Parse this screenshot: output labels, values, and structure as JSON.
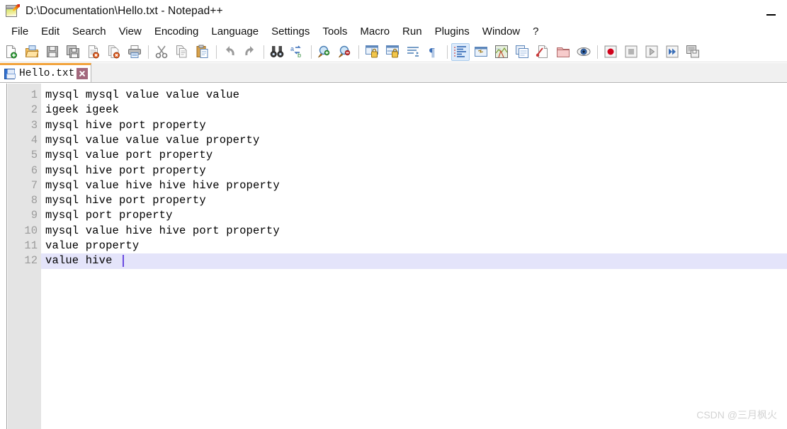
{
  "window": {
    "title": "D:\\Documentation\\Hello.txt - Notepad++",
    "app_icon": "notepad-plus-plus-icon",
    "minimize_label": "—"
  },
  "menu": {
    "items": [
      {
        "label": "File"
      },
      {
        "label": "Edit"
      },
      {
        "label": "Search"
      },
      {
        "label": "View"
      },
      {
        "label": "Encoding"
      },
      {
        "label": "Language"
      },
      {
        "label": "Settings"
      },
      {
        "label": "Tools"
      },
      {
        "label": "Macro"
      },
      {
        "label": "Run"
      },
      {
        "label": "Plugins"
      },
      {
        "label": "Window"
      },
      {
        "label": "?"
      }
    ]
  },
  "toolbar": {
    "buttons": [
      {
        "name": "new-file-icon",
        "tip": "New"
      },
      {
        "name": "open-file-icon",
        "tip": "Open"
      },
      {
        "name": "save-icon",
        "tip": "Save"
      },
      {
        "name": "save-all-icon",
        "tip": "Save All"
      },
      {
        "name": "close-file-icon",
        "tip": "Close"
      },
      {
        "name": "close-all-files-icon",
        "tip": "Close All"
      },
      {
        "name": "print-icon",
        "tip": "Print"
      },
      {
        "name": "separator",
        "tip": ""
      },
      {
        "name": "cut-icon",
        "tip": "Cut"
      },
      {
        "name": "copy-icon",
        "tip": "Copy"
      },
      {
        "name": "paste-icon",
        "tip": "Paste"
      },
      {
        "name": "separator",
        "tip": ""
      },
      {
        "name": "undo-icon",
        "tip": "Undo"
      },
      {
        "name": "redo-icon",
        "tip": "Redo"
      },
      {
        "name": "separator",
        "tip": ""
      },
      {
        "name": "find-icon",
        "tip": "Find"
      },
      {
        "name": "replace-icon",
        "tip": "Replace"
      },
      {
        "name": "separator",
        "tip": ""
      },
      {
        "name": "zoom-in-icon",
        "tip": "Zoom In"
      },
      {
        "name": "zoom-out-icon",
        "tip": "Zoom Out"
      },
      {
        "name": "separator",
        "tip": ""
      },
      {
        "name": "sync-vertical-scroll-icon",
        "tip": "Synchronize Vertical Scrolling"
      },
      {
        "name": "sync-horizontal-scroll-icon",
        "tip": "Synchronize Horizontal Scrolling"
      },
      {
        "name": "word-wrap-icon",
        "tip": "Word wrap"
      },
      {
        "name": "show-all-characters-icon",
        "tip": "Show All Characters"
      },
      {
        "name": "separator",
        "tip": ""
      },
      {
        "name": "show-indent-guide-icon",
        "tip": "Show Indent Guide",
        "active": true
      },
      {
        "name": "user-defined-dialog-icon",
        "tip": "UserDefine Dialogue"
      },
      {
        "name": "document-map-icon",
        "tip": "Document Map"
      },
      {
        "name": "function-list-icon",
        "tip": "Function List"
      },
      {
        "name": "document-switcher-icon",
        "tip": "Document Switcher"
      },
      {
        "name": "folder-as-workspace-icon",
        "tip": "Folder as Workspace"
      },
      {
        "name": "monitoring-icon",
        "tip": "Monitoring (tail -f)"
      },
      {
        "name": "separator",
        "tip": ""
      },
      {
        "name": "record-macro-icon",
        "tip": "Start Recording"
      },
      {
        "name": "stop-macro-icon",
        "tip": "Stop Recording"
      },
      {
        "name": "play-macro-icon",
        "tip": "Playback"
      },
      {
        "name": "run-macro-multiple-icon",
        "tip": "Run a Macro Multiple Times"
      },
      {
        "name": "save-macro-icon",
        "tip": "Save Current Recorded Macro"
      }
    ]
  },
  "tabs": {
    "active_index": 0,
    "items": [
      {
        "label": "Hello.txt",
        "saved_icon": "save-icon",
        "close_label": "close-icon"
      }
    ]
  },
  "editor": {
    "current_line": 12,
    "caret_line": 12,
    "caret_column": 11,
    "lines": [
      {
        "number": "1",
        "text": "mysql mysql value value value"
      },
      {
        "number": "2",
        "text": "igeek igeek"
      },
      {
        "number": "3",
        "text": "mysql hive port property"
      },
      {
        "number": "4",
        "text": "mysql value value value property"
      },
      {
        "number": "5",
        "text": "mysql value port property"
      },
      {
        "number": "6",
        "text": "mysql hive port property"
      },
      {
        "number": "7",
        "text": "mysql value hive hive hive property"
      },
      {
        "number": "8",
        "text": "mysql hive port property"
      },
      {
        "number": "9",
        "text": "mysql port property"
      },
      {
        "number": "10",
        "text": "mysql value hive hive port property"
      },
      {
        "number": "11",
        "text": "value property"
      },
      {
        "number": "12",
        "text": "value hive"
      }
    ]
  },
  "watermark": {
    "text": "CSDN @三月枫火"
  },
  "colors": {
    "tab_accent": "#f2a33c",
    "current_line": "#e4e4fa",
    "gutter": "#e4e4e4",
    "line_number": "#9b9b9b",
    "caret": "#6a4be0",
    "tab_close": "#a3687d",
    "toolbar_active": "#ddebfb"
  }
}
